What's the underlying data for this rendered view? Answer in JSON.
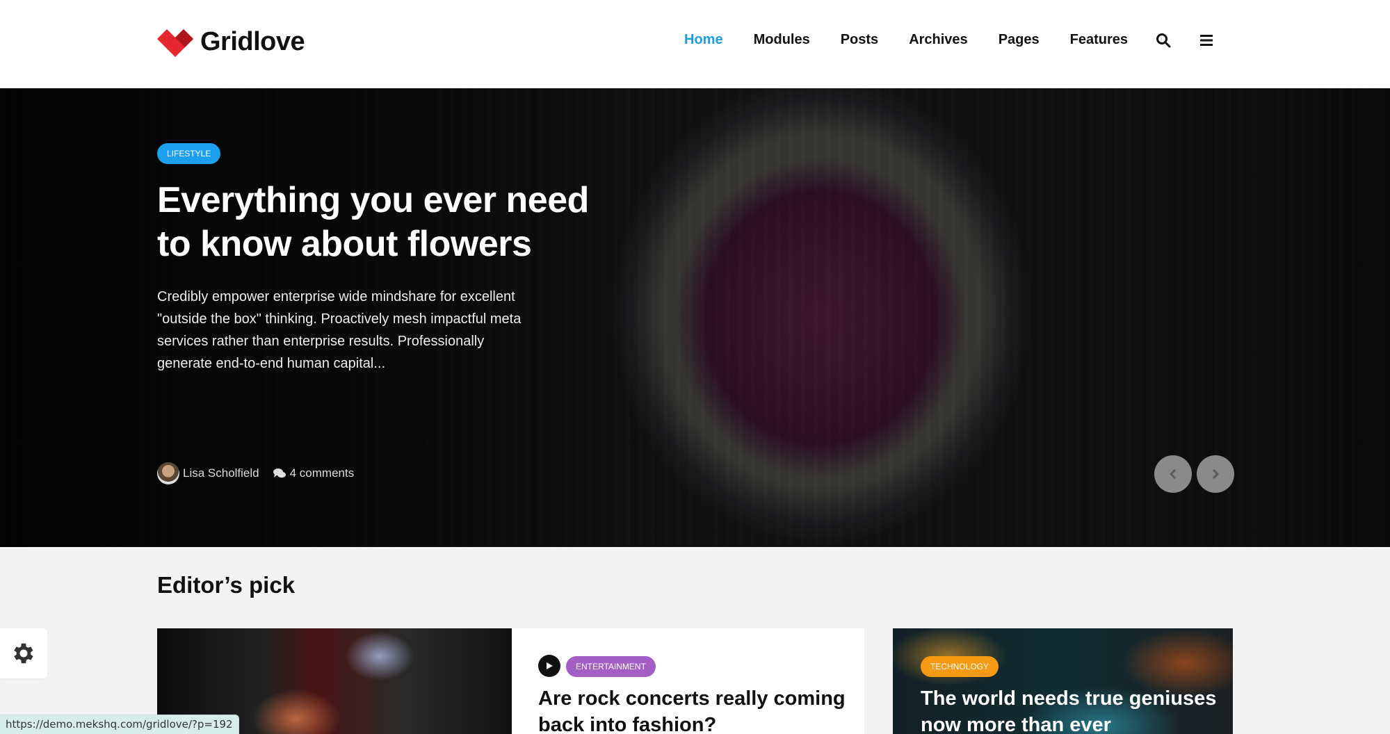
{
  "header": {
    "logo_text": "Gridlove",
    "nav": [
      {
        "label": "Home",
        "active": true
      },
      {
        "label": "Modules",
        "active": false
      },
      {
        "label": "Posts",
        "active": false
      },
      {
        "label": "Archives",
        "active": false
      },
      {
        "label": "Pages",
        "active": false
      },
      {
        "label": "Features",
        "active": false
      }
    ],
    "icons": [
      "search-icon",
      "menu-icon"
    ],
    "accent_color": "#1e9de6"
  },
  "hero": {
    "category": "LIFESTYLE",
    "category_color": "#1ea0f0",
    "title": "Everything you ever need to know about flowers",
    "excerpt": "Credibly empower enterprise wide mindshare for excellent \"outside the box\" thinking. Proactively mesh impactful meta services rather than enterprise results. Professionally generate end-to-end human capital...",
    "author": "Lisa Scholfield",
    "comments": "4 comments"
  },
  "editors_pick": {
    "title": "Editor’s pick",
    "cards": [
      {
        "category": "ENTERTAINMENT",
        "category_color": "#a35fc5",
        "title": "Are rock concerts really coming back into fashion?",
        "format": "video"
      },
      {
        "category": "TECHNOLOGY",
        "category_color": "#f59a12",
        "title": "The world needs true geniuses now more than ever"
      }
    ]
  },
  "status_url": "https://demo.mekshq.com/gridlove/?p=192"
}
